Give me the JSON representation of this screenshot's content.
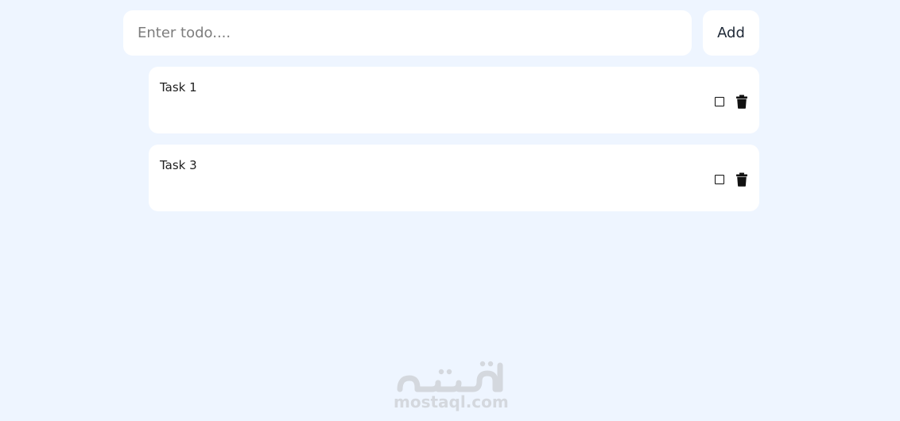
{
  "input": {
    "placeholder": "Enter todo....",
    "value": ""
  },
  "add_button": {
    "label": "Add"
  },
  "todos": [
    {
      "text": "Task 1",
      "done": false
    },
    {
      "text": "Task 3",
      "done": false
    }
  ],
  "icons": {
    "checkbox": "square-outline-icon",
    "delete": "trash-icon"
  },
  "watermark": {
    "text": "mostaql.com"
  },
  "colors": {
    "background": "#eef5ff",
    "card": "#ffffff",
    "text": "#1f1f1f",
    "icon": "#111111",
    "watermark": "#d4d8de"
  }
}
